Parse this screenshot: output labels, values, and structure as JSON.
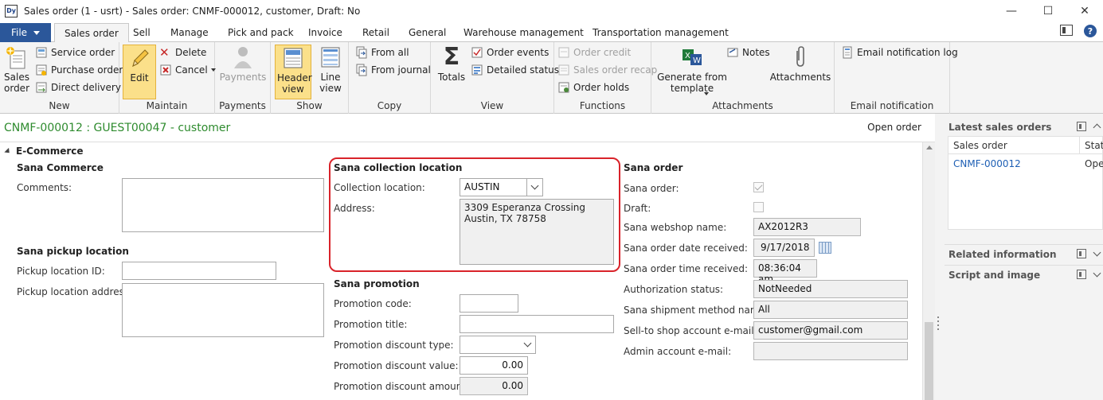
{
  "window": {
    "title": "Sales order (1 - usrt) - Sales order: CNMF-000012, customer, Draft: No",
    "app_icon_text": "Dy",
    "controls": {
      "minimize": "—",
      "maximize": "☐",
      "close": "✕"
    }
  },
  "ribbon_tabs": {
    "file": "File",
    "tabs": [
      "Sales order",
      "Sell",
      "Manage",
      "Pick and pack",
      "Invoice",
      "Retail",
      "General",
      "Warehouse management",
      "Transportation management"
    ],
    "active": "Sales order"
  },
  "ribbon": {
    "new": {
      "label": "New",
      "sales_order": "Sales order",
      "service_order": "Service order",
      "purchase_order": "Purchase order",
      "direct_delivery": "Direct delivery"
    },
    "maintain": {
      "label": "Maintain",
      "edit": "Edit",
      "delete": "Delete",
      "cancel": "Cancel"
    },
    "payments": {
      "label": "Payments",
      "payments": "Payments"
    },
    "show": {
      "label": "Show",
      "header_view": "Header view",
      "line_view": "Line view"
    },
    "copy": {
      "label": "Copy",
      "from_all": "From all",
      "from_journal": "From journal"
    },
    "view": {
      "label": "View",
      "totals": "Totals",
      "order_events": "Order events",
      "detailed_status": "Detailed status"
    },
    "functions": {
      "label": "Functions",
      "order_credit": "Order credit",
      "sales_order_recap": "Sales order recap",
      "order_holds": "Order holds"
    },
    "attachments": {
      "label": "Attachments",
      "generate_from_template": "Generate from template",
      "notes": "Notes",
      "attachments": "Attachments"
    },
    "email_notification": {
      "label": "Email notification",
      "email_notification_log": "Email notification log"
    }
  },
  "header": {
    "record_title": "CNMF-000012 : GUEST00047 - customer",
    "open_order": "Open order"
  },
  "form": {
    "fasttab_title": "E-Commerce",
    "sana_commerce": {
      "title": "Sana Commerce",
      "comments_label": "Comments:",
      "comments_value": ""
    },
    "sana_pickup": {
      "title": "Sana pickup location",
      "pickup_id_label": "Pickup location ID:",
      "pickup_id_value": "",
      "pickup_address_label": "Pickup location address:",
      "pickup_address_value": ""
    },
    "sana_collection": {
      "title": "Sana collection location",
      "collection_label": "Collection location:",
      "collection_value": "AUSTIN",
      "address_label": "Address:",
      "address_line1": "3309 Esperanza Crossing",
      "address_line2": "Austin, TX 78758"
    },
    "sana_promotion": {
      "title": "Sana promotion",
      "code_label": "Promotion code:",
      "code_value": "",
      "title_label": "Promotion title:",
      "title_value": "",
      "discount_type_label": "Promotion discount type:",
      "discount_type_value": "",
      "discount_value_label": "Promotion discount value:",
      "discount_value_value": "0.00",
      "discount_amount_label": "Promotion discount amount:",
      "discount_amount_value": "0.00"
    },
    "sana_order": {
      "title": "Sana order",
      "sana_order_label": "Sana order:",
      "sana_order_checked": true,
      "draft_label": "Draft:",
      "draft_checked": false,
      "webshop_label": "Sana webshop name:",
      "webshop_value": "AX2012R3",
      "date_label": "Sana order date received:",
      "date_value": "9/17/2018",
      "time_label": "Sana order time received:",
      "time_value": "08:36:04 am",
      "auth_label": "Authorization status:",
      "auth_value": "NotNeeded",
      "shipment_label": "Sana shipment method name:",
      "shipment_value": "All",
      "sell_to_email_label": "Sell-to shop account e-mail:",
      "sell_to_email_value": "customer@gmail.com",
      "admin_email_label": "Admin account e-mail:",
      "admin_email_value": ""
    }
  },
  "factbox": {
    "latest_title": "Latest sales orders",
    "columns": [
      "Sales order",
      "Stat"
    ],
    "rows": [
      {
        "sales_order": "CNMF-000012",
        "status": "Ope"
      }
    ],
    "related_title": "Related information",
    "script_title": "Script and image"
  },
  "colors": {
    "accent": "#2b579a",
    "record_title": "#2e8b2e",
    "link": "#1e5fb4",
    "highlight_border": "#d9232a"
  }
}
